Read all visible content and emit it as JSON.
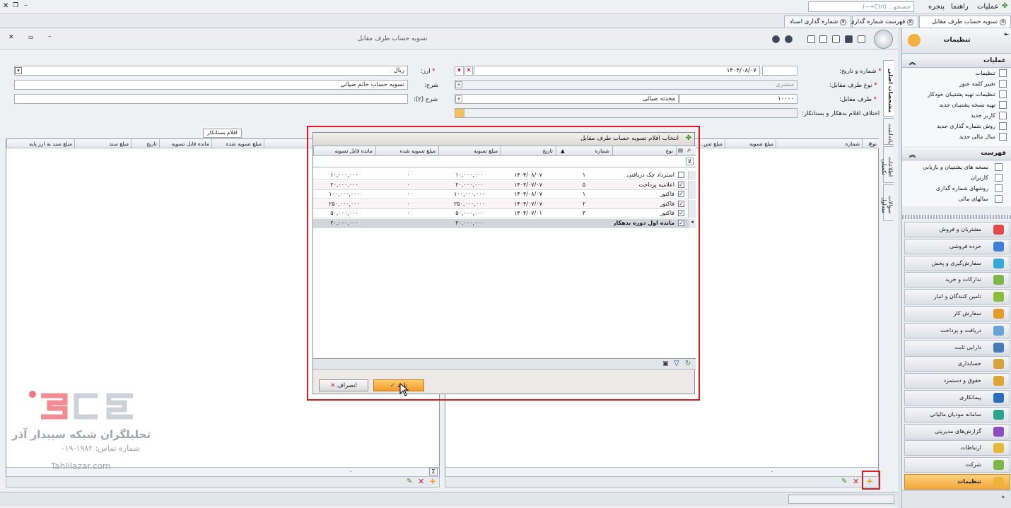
{
  "menubar": {
    "items": [
      "عملیات",
      "راهنما",
      "پنجره"
    ],
    "search_placeholder": "جستجو... (Ctrl+~)"
  },
  "tabs": [
    {
      "label": "تسویه حساب طرف مقابل"
    },
    {
      "label": "فهرست شماره گذاری"
    },
    {
      "label": "شماره گذاری اسناد"
    }
  ],
  "sidebar": {
    "header_title": "تنظیمات",
    "operations_title": "عملیات",
    "operations": [
      "تنظیمات",
      "تغییر کلمه عبور",
      "تنظیمات تهیه پشتیبان خودکار",
      "تهیه نسخه پشتیبان جدید",
      "کاربر جدید",
      "روش شماره گذاری جدید",
      "سال مالی جدید"
    ],
    "list_title": "فهرست",
    "list": [
      "نسخه های پشتیبان و بازیابی",
      "کاربران",
      "روشهای شماره گذاری",
      "سالهای مالی"
    ],
    "modules": [
      "مشتریان و فروش",
      "خرده فروشی",
      "سفارش‌گیری و پخش",
      "تدارکات و خرید",
      "تامین کنندگان و انبار",
      "سفارش کار",
      "دریافت و پرداخت",
      "دارایی ثابت",
      "حسابداری",
      "حقوق و دستمزد",
      "پیمانکاری",
      "سامانه مودیان مالیاتی",
      "گزارش‌های مدیریتی",
      "ارتباطات",
      "شرکت",
      "تنظیمات"
    ],
    "active_module": "تنظیمات"
  },
  "window": {
    "title": "تسویه حساب طرف مقابل"
  },
  "form": {
    "number_date_label": "شماره و تاریخ:",
    "date_value": "۱۴۰۴/۰۸/۰۷",
    "party_type_label": "نوع طرف مقابل:",
    "party_type_value": "مشتری",
    "party_label": "طرف مقابل:",
    "party_code": "۱۰۰۰۰",
    "party_name": "محدثه ضیائی",
    "diff_label": "اختلاف اقلام بدهکار و بستانکار:",
    "currency_label": "ارز:",
    "currency_value": "ریال",
    "desc_label": "شرح:",
    "desc_value": "تسویه حساب خانم ضیائی",
    "desc2_label": "شرح (۲):"
  },
  "vertical_tabs": [
    "مشخصات اصلی",
    "یادداشت",
    "اطلاعات تکمیلی",
    "سوالات متداول"
  ],
  "creditor_panel": {
    "title": "اقلام بستانکار",
    "columns": [
      "مبلغ سند به ارز پایه",
      "مبلغ سند",
      "تاریخ",
      "مانده قابل تسویه",
      "مبلغ تسویه شده"
    ],
    "total": "۰"
  },
  "debtor_panel": {
    "columns": [
      "نوع",
      "شماره",
      "مبلغ تسویه",
      "مبلغ تس..."
    ],
    "total": "۰"
  },
  "dialog": {
    "title": "انتخاب اقلام تسویه حساب طرف مقابل",
    "columns": [
      "نوع",
      "شماره",
      "تاریخ",
      "مبلغ تسویه",
      "مبلغ تسویه شده",
      "مانده قابل تسویه"
    ],
    "rows": [
      {
        "checked": false,
        "type": "استرداد چک دریافتی",
        "number": "۱",
        "date": "۱۴۰۴/۰۸/۰۷",
        "amount": "۱۰,۰۰۰,۰۰۰",
        "settled": "۰",
        "remaining": "۱۰,۰۰۰,۰۰۰"
      },
      {
        "checked": true,
        "type": "اعلامیه پرداخت",
        "number": "۵",
        "date": "۱۴۰۴/۰۷/۰۷",
        "amount": "۲۰,۰۰۰,۰۰۰",
        "settled": "۰",
        "remaining": "۲۰,۰۰۰,۰۰۰"
      },
      {
        "checked": true,
        "type": "فاکتور",
        "number": "۱",
        "date": "۱۴۰۴/۰۸/۰۷",
        "amount": "۱۰۰,۰۰۰,۰۰۰",
        "settled": "۰",
        "remaining": "۱۰۰,۰۰۰,۰۰۰"
      },
      {
        "checked": true,
        "type": "فاکتور",
        "number": "۲",
        "date": "۱۴۰۴/۰۷/۰۷",
        "amount": "۲۵۰,۰۰۰,۰۰۰",
        "settled": "۰",
        "remaining": "۲۵۰,۰۰۰,۰۰۰"
      },
      {
        "checked": true,
        "type": "فاکتور",
        "number": "۳",
        "date": "۱۴۰۴/۰۷/۰۱",
        "amount": "۵۰,۰۰۰,۰۰۰",
        "settled": "۰",
        "remaining": "۵۰,۰۰۰,۰۰۰"
      },
      {
        "checked": true,
        "type": "مانده اول دوره بدهکار",
        "number": "",
        "date": "",
        "amount": "۲۰,۰۰۰,۰۰۰",
        "settled": "",
        "remaining": "۲۰,۰۰۰,۰۰۰"
      }
    ],
    "ok_label": "تایید",
    "cancel_label": "انصراف"
  },
  "watermark": {
    "brand": "تحلیلگران شبکه سپیدار آذر",
    "phone": "شماره تماس: ۱۹۸۲-۰۱۹",
    "site": "Tahlilazar.com"
  },
  "colors": {
    "accent": "#f4a53b",
    "highlight": "#d71d24",
    "brand": "#e8414b"
  }
}
